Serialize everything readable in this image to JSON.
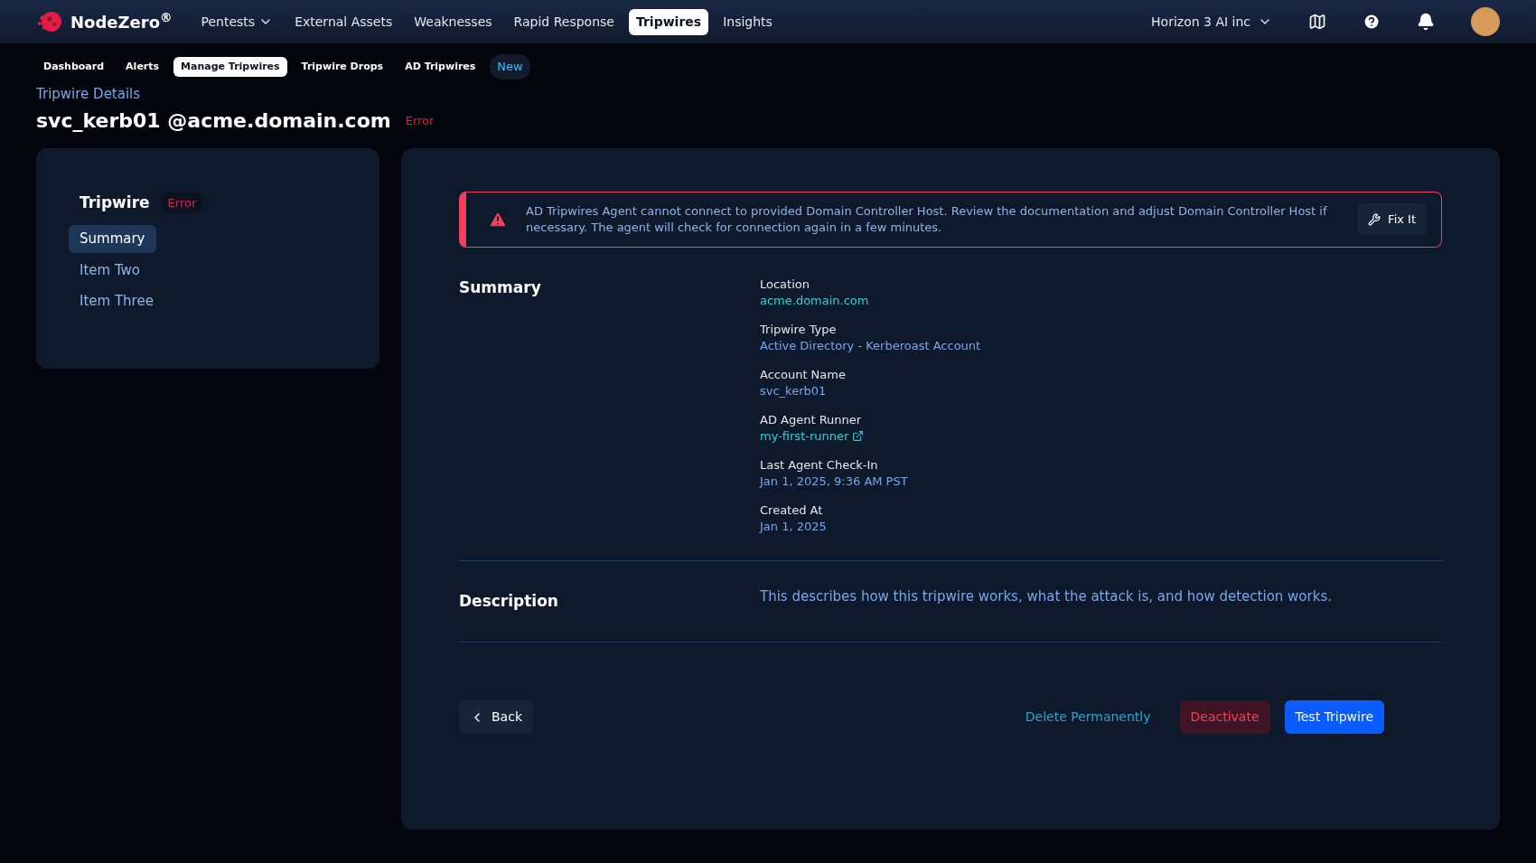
{
  "brand": {
    "name": "NodeZero$^{®}$"
  },
  "nav": [
    {
      "label": "Pentests",
      "dropdown": true,
      "selected": false
    },
    {
      "label": "External Assets",
      "dropdown": false,
      "selected": false
    },
    {
      "label": "Weaknesses",
      "dropdown": false,
      "selected": false
    },
    {
      "label": "Rapid Response",
      "dropdown": false,
      "selected": false
    },
    {
      "label": "Tripwires",
      "dropdown": false,
      "selected": true
    },
    {
      "label": "Insights",
      "dropdown": false,
      "selected": false
    }
  ],
  "org": {
    "label": "Horizon 3 AI inc"
  },
  "subnav": [
    {
      "label": "Dashboard",
      "kind": "tab",
      "selected": false
    },
    {
      "label": "Alerts",
      "kind": "tab",
      "selected": false
    },
    {
      "label": "Manage Tripwires",
      "kind": "tab",
      "selected": true
    },
    {
      "label": "Tripwire Drops",
      "kind": "tab",
      "selected": false
    },
    {
      "label": "AD Tripwires",
      "kind": "tab",
      "selected": false
    }
  ],
  "subnav_badge": "New",
  "breadcrumb": "Tripwire Details",
  "page_title": "svc_kerb01 @acme.domain.com",
  "page_status": "Error",
  "sidebar": {
    "title": "Tripwire",
    "status": "Error",
    "items": [
      {
        "label": "Summary",
        "selected": true
      },
      {
        "label": "Item Two",
        "selected": false
      },
      {
        "label": "Item Three",
        "selected": false
      }
    ]
  },
  "alert": {
    "message": "AD Tripwires Agent cannot connect to provided Domain Controller Host. Review the documentation and adjust Domain Controller Host if necessary. The agent will check for connection again in a few minutes.",
    "action": "Fix It"
  },
  "summary": {
    "heading": "Summary",
    "fields": [
      {
        "label": "Location",
        "value": "acme.domain.com",
        "kind": "link",
        "external": false
      },
      {
        "label": "Tripwire Type",
        "value": "Active Directory - Kerberoast Account",
        "kind": "text",
        "external": false
      },
      {
        "label": "Account Name",
        "value": "svc_kerb01",
        "kind": "text",
        "external": false
      },
      {
        "label": "AD Agent Runner",
        "value": "my-first-runner",
        "kind": "link",
        "external": true
      },
      {
        "label": "Last Agent Check-In",
        "value": "Jan 1, 2025, 9:36 AM PST",
        "kind": "text",
        "external": false
      },
      {
        "label": "Created At",
        "value": "Jan 1, 2025",
        "kind": "text",
        "external": false
      }
    ]
  },
  "description": {
    "heading": "Description",
    "text": "This describes how this tripwire works, what the attack is, and how detection works."
  },
  "buttons": {
    "back": "Back",
    "delete": "Delete Permanently",
    "deactivate": "Deactivate",
    "test": "Test Tripwire"
  }
}
